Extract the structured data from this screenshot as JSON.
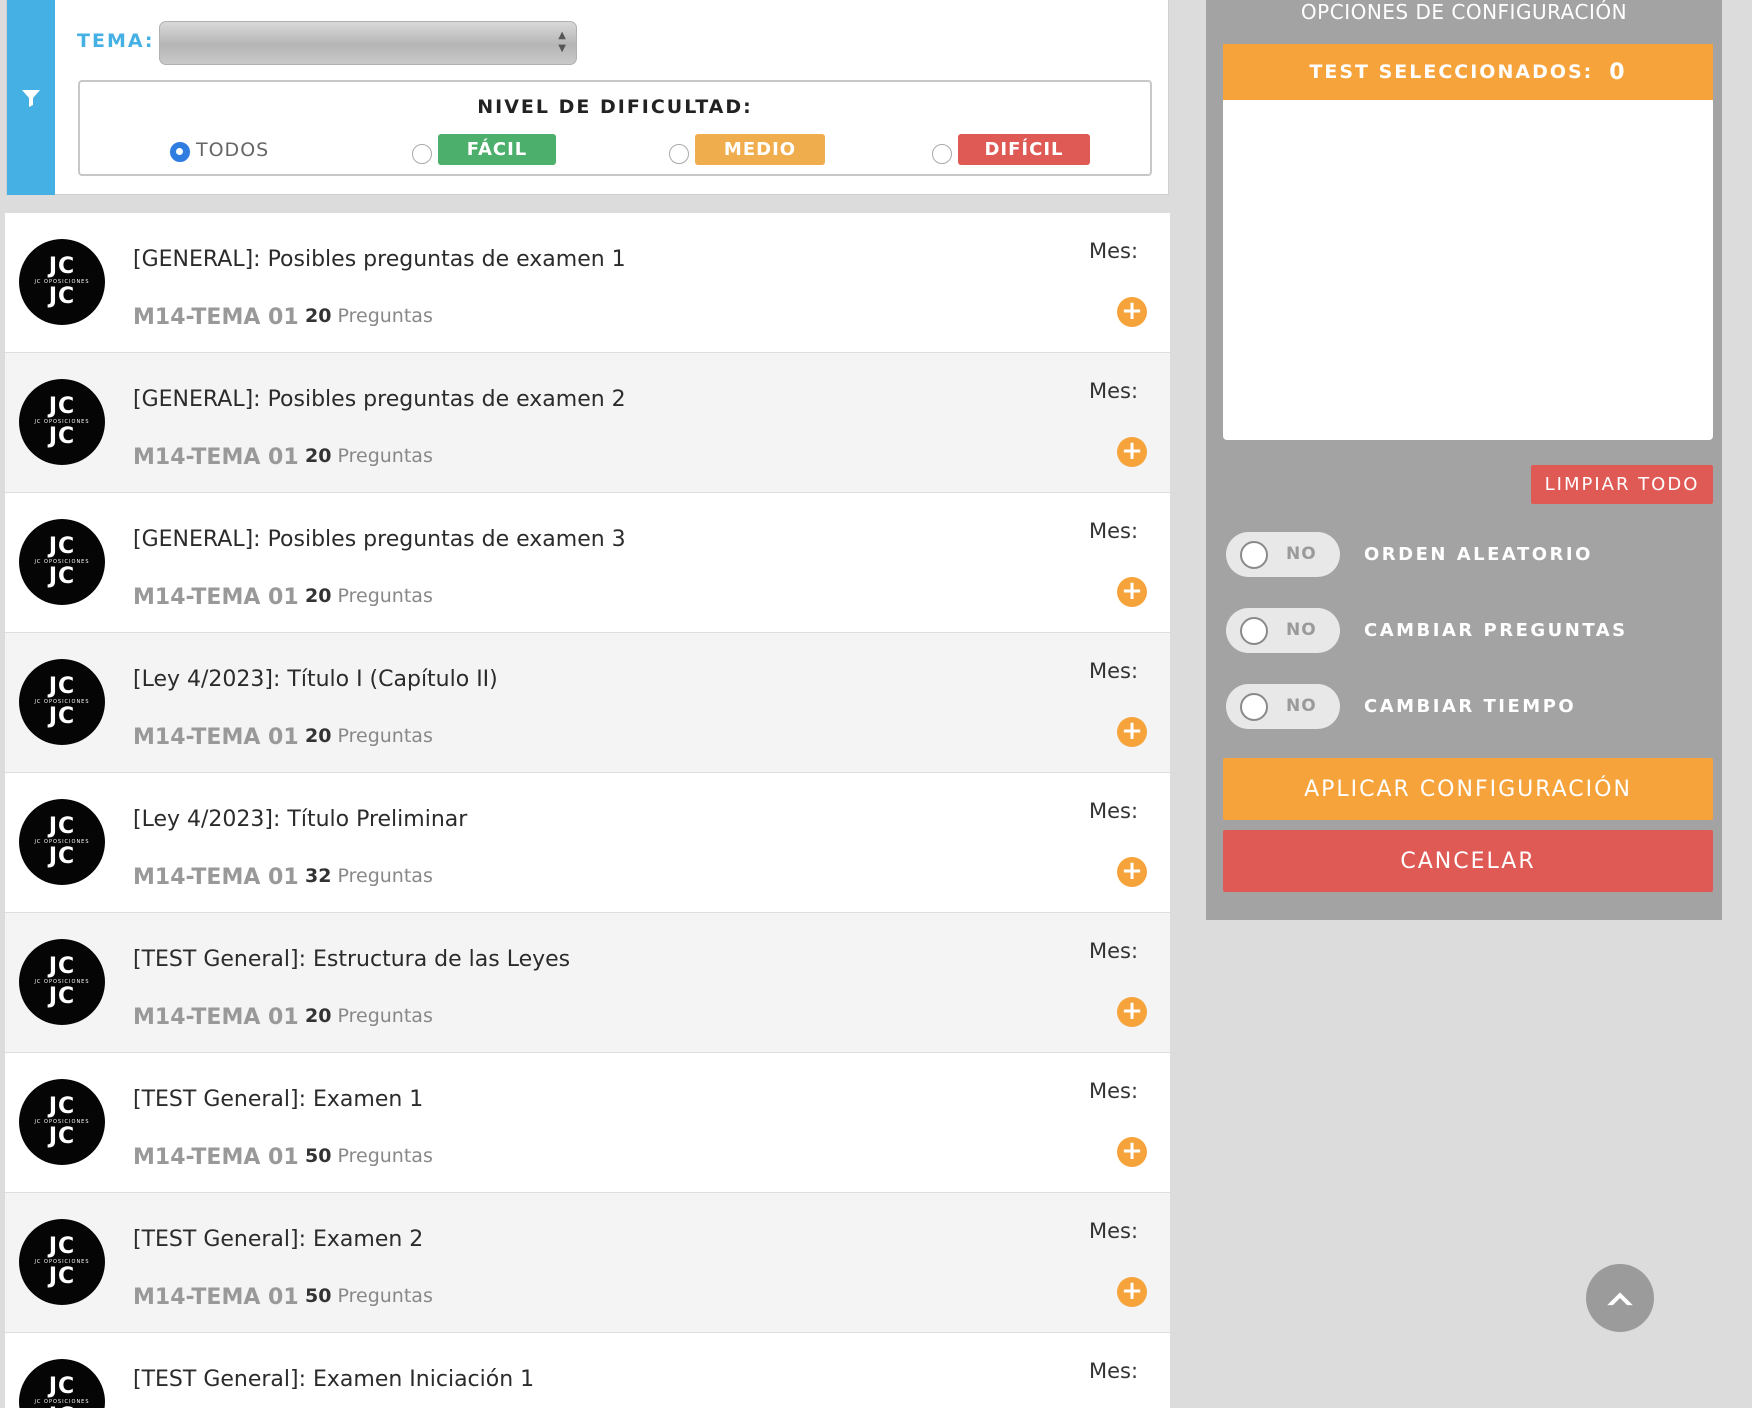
{
  "filter": {
    "tema_label": "TEMA:",
    "difficulty_title": "NIVEL DE DIFICULTAD:",
    "options": {
      "todos": "TODOS",
      "facil": "FÁCIL",
      "medio": "MEDIO",
      "dificil": "DIFÍCIL"
    },
    "selected": "todos",
    "colors": {
      "facil": "#4caf6b",
      "medio": "#f0ad4e",
      "dificil": "#e05a55",
      "accent": "#45b0e4"
    }
  },
  "tests": [
    {
      "title": "[GENERAL]: Posibles preguntas de examen 1",
      "tema": "M14-TEMA 01",
      "count": "20",
      "count_label": "Preguntas",
      "mes_label": "Mes:"
    },
    {
      "title": "[GENERAL]: Posibles preguntas de examen 2",
      "tema": "M14-TEMA 01",
      "count": "20",
      "count_label": "Preguntas",
      "mes_label": "Mes:"
    },
    {
      "title": "[GENERAL]: Posibles preguntas de examen 3",
      "tema": "M14-TEMA 01",
      "count": "20",
      "count_label": "Preguntas",
      "mes_label": "Mes:"
    },
    {
      "title": "[Ley 4/2023]: Título I (Capítulo II)",
      "tema": "M14-TEMA 01",
      "count": "20",
      "count_label": "Preguntas",
      "mes_label": "Mes:"
    },
    {
      "title": "[Ley 4/2023]: Título Preliminar",
      "tema": "M14-TEMA 01",
      "count": "32",
      "count_label": "Preguntas",
      "mes_label": "Mes:"
    },
    {
      "title": "[TEST General]: Estructura de las Leyes",
      "tema": "M14-TEMA 01",
      "count": "20",
      "count_label": "Preguntas",
      "mes_label": "Mes:"
    },
    {
      "title": "[TEST General]: Examen 1",
      "tema": "M14-TEMA 01",
      "count": "50",
      "count_label": "Preguntas",
      "mes_label": "Mes:"
    },
    {
      "title": "[TEST General]: Examen 2",
      "tema": "M14-TEMA 01",
      "count": "50",
      "count_label": "Preguntas",
      "mes_label": "Mes:"
    },
    {
      "title": "[TEST General]: Examen Iniciación 1",
      "tema": "M14-TEMA 01",
      "count": "",
      "count_label": "",
      "mes_label": "Mes:"
    }
  ],
  "logo": {
    "top": "JC",
    "middle": "JC OPOSICIONES",
    "bottom": "JC"
  },
  "add_icon": "plus-circle-icon",
  "config": {
    "title": "OPCIONES DE CONFIGURACIÓN",
    "selected_label": "TEST SELECCIONADOS:",
    "selected_count": "0",
    "clear_label": "LIMPIAR TODO",
    "options": [
      {
        "value": "NO",
        "label": "ORDEN ALEATORIO"
      },
      {
        "value": "NO",
        "label": "CAMBIAR PREGUNTAS"
      },
      {
        "value": "NO",
        "label": "CAMBIAR TIEMPO"
      }
    ],
    "apply_label": "APLICAR CONFIGURACIÓN",
    "cancel_label": "CANCELAR"
  }
}
